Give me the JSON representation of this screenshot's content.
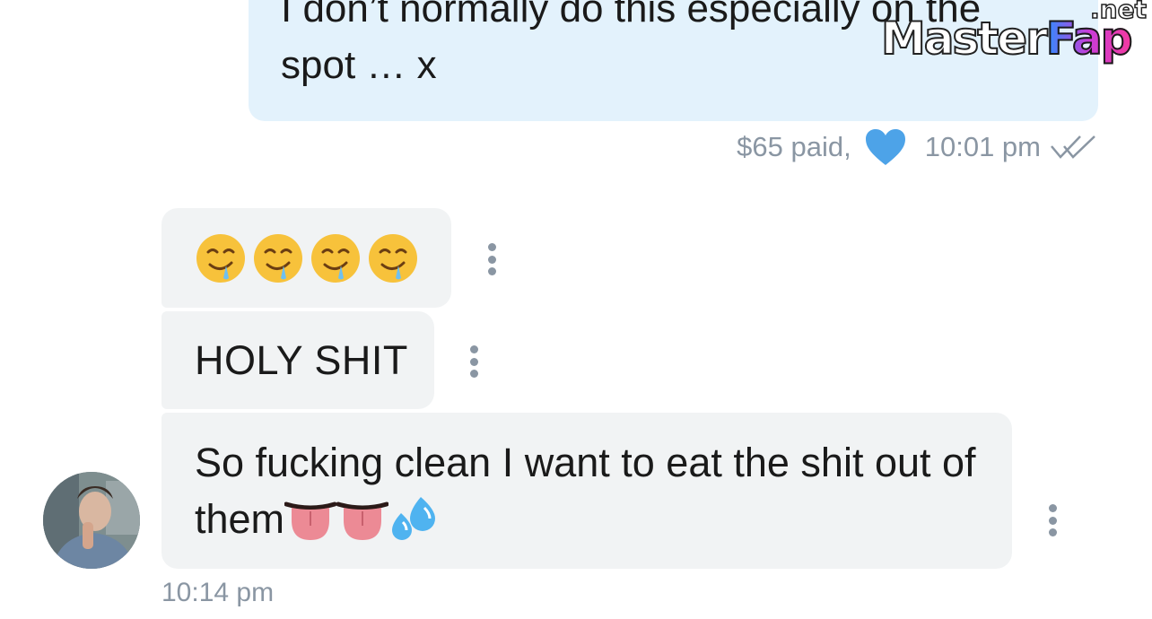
{
  "conversation": {
    "outgoing": {
      "text": "I don’t normally do this especially on the\nspot … x",
      "paid_label": "$65 paid,",
      "time": "10:01 pm",
      "heart_color": "#4da3e8",
      "icons": [
        "heart-icon",
        "double-check-icon"
      ]
    },
    "incoming": [
      {
        "type": "emoji",
        "emoji_name": "drooling-face",
        "emoji_count": 4
      },
      {
        "type": "text",
        "text": "HOLY SHIT"
      },
      {
        "type": "text",
        "text": "So fucking clean I want to eat the shit out of them",
        "trailing_emoji": [
          "tongue",
          "tongue",
          "sweat-droplets"
        ]
      }
    ],
    "incoming_time": "10:14 pm",
    "avatar": "avatar"
  },
  "watermark": {
    "main": "Master",
    "accent": "Fap",
    "suffix": ".net"
  },
  "colors": {
    "outgoing_bubble": "#e3f2fc",
    "incoming_bubble": "#f1f3f4",
    "meta_text": "#8a96a3"
  }
}
